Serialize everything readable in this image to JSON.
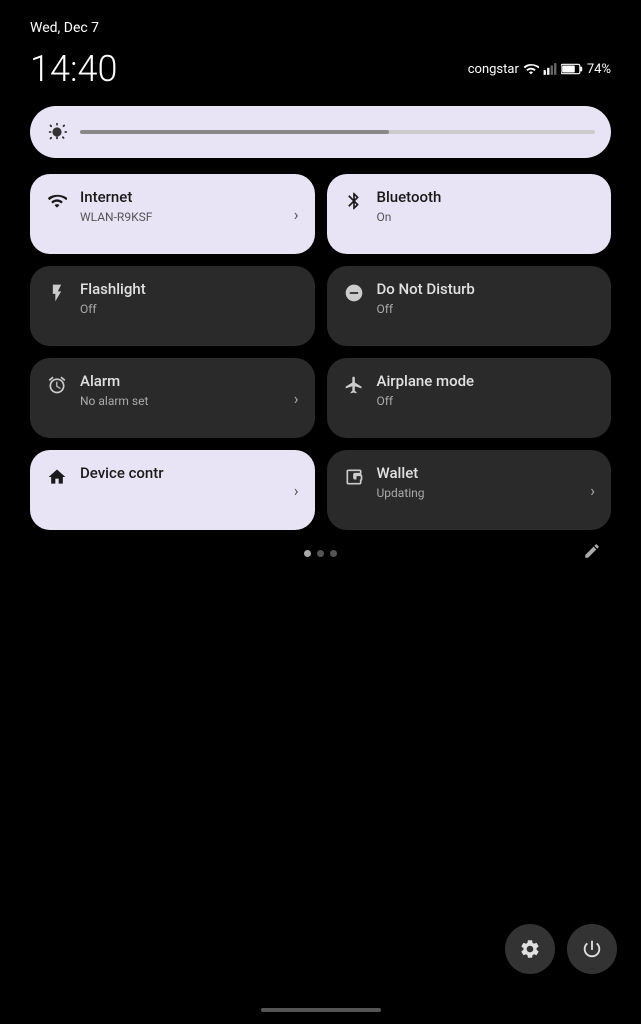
{
  "statusBar": {
    "date": "Wed, Dec 7",
    "carrier": "congstar",
    "battery": "74%"
  },
  "clock": {
    "time": "14:40"
  },
  "brightness": {
    "level": 60
  },
  "tiles": [
    {
      "id": "internet",
      "title": "Internet",
      "subtitle": "WLAN-R9KSF",
      "state": "light",
      "hasChevron": true,
      "icon": "wifi"
    },
    {
      "id": "bluetooth",
      "title": "Bluetooth",
      "subtitle": "On",
      "state": "light",
      "hasChevron": false,
      "icon": "bluetooth"
    },
    {
      "id": "flashlight",
      "title": "Flashlight",
      "subtitle": "Off",
      "state": "dark",
      "hasChevron": false,
      "icon": "flashlight"
    },
    {
      "id": "dnd",
      "title": "Do Not Disturb",
      "subtitle": "Off",
      "state": "dark",
      "hasChevron": false,
      "icon": "dnd"
    },
    {
      "id": "alarm",
      "title": "Alarm",
      "subtitle": "No alarm set",
      "state": "dark",
      "hasChevron": true,
      "icon": "alarm"
    },
    {
      "id": "airplane",
      "title": "Airplane mode",
      "subtitle": "Off",
      "state": "dark",
      "hasChevron": false,
      "icon": "airplane"
    },
    {
      "id": "device",
      "title": "Device contr",
      "subtitle": "",
      "state": "light",
      "hasChevron": true,
      "icon": "home"
    },
    {
      "id": "wallet",
      "title": "Wallet",
      "subtitle": "Updating",
      "state": "dark",
      "hasChevron": true,
      "icon": "wallet"
    }
  ],
  "pagination": {
    "dots": 3,
    "active": 0
  },
  "bottomButtons": {
    "settings": "Settings",
    "power": "Power"
  }
}
